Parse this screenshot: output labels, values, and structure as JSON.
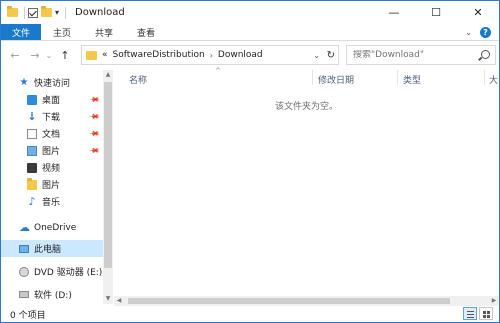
{
  "window": {
    "title": "Download",
    "controls": {
      "minimize": "—",
      "maximize": "☐",
      "close": "✕"
    }
  },
  "quick_access_toolbar": {
    "icons": [
      "folder-icon",
      "properties-icon",
      "new-folder-icon"
    ],
    "dropdown": "▾"
  },
  "ribbon": {
    "tabs": [
      "文件",
      "主页",
      "共享",
      "查看"
    ],
    "expand_glyph": "⌄",
    "help_glyph": "?"
  },
  "navigation": {
    "back": "←",
    "forward": "→",
    "recent": "⌄",
    "up": "↑"
  },
  "address_bar": {
    "prefix": "«",
    "segments": [
      "SoftwareDistribution",
      "Download"
    ],
    "separator": "›",
    "dropdown": "⌄",
    "refresh": "↻"
  },
  "search": {
    "placeholder": "搜索\"Download\""
  },
  "nav_pane": {
    "quick_access": {
      "label": "快速访问",
      "items": [
        {
          "label": "桌面",
          "pinned": true
        },
        {
          "label": "下载",
          "pinned": true
        },
        {
          "label": "文档",
          "pinned": true
        },
        {
          "label": "图片",
          "pinned": true
        },
        {
          "label": "视频",
          "pinned": false
        },
        {
          "label": "图片",
          "pinned": false
        },
        {
          "label": "音乐",
          "pinned": false
        }
      ]
    },
    "onedrive": "OneDrive",
    "this_pc": "此电脑",
    "dvd_drive": "DVD 驱动器 (E:) S",
    "software_drive": "软件 (D:)",
    "pin_glyph": "📌"
  },
  "columns": {
    "name": "名称",
    "date_modified": "修改日期",
    "type": "类型",
    "size": "大"
  },
  "content": {
    "empty_message": "该文件夹为空。",
    "sort_glyph": "^"
  },
  "status_bar": {
    "item_count": "0 个项目"
  },
  "colors": {
    "accent": "#1979ca",
    "selection": "#cce8ff",
    "window_border": "#2b79d0"
  }
}
